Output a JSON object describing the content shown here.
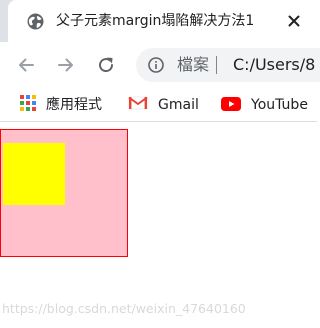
{
  "tab": {
    "title": "父子元素margin塌陷解决方法1",
    "favicon_icon": "globe-icon",
    "close_icon": "close-icon"
  },
  "toolbar": {
    "back_icon": "arrow-left-icon",
    "forward_icon": "arrow-right-icon",
    "reload_icon": "reload-icon",
    "info_icon": "info-icon",
    "security_label": "檔案",
    "url": "C:/Users/8"
  },
  "bookmarks": [
    {
      "label": "應用程式",
      "icon": "apps-grid-icon"
    },
    {
      "label": "Gmail",
      "icon": "gmail-icon"
    },
    {
      "label": "YouTube",
      "icon": "youtube-icon"
    }
  ],
  "page": {
    "parent_box": {
      "color": "#ffc0cb",
      "border_color": "#ff0000"
    },
    "child_box": {
      "color": "#ffff00"
    },
    "watermark": "https://blog.csdn.net/weixin_47640160"
  },
  "colors": {
    "tab_strip": "#dee1e6",
    "omnibox": "#f1f3f4",
    "youtube_red": "#ff0000",
    "gmail_red": "#ea4335"
  }
}
